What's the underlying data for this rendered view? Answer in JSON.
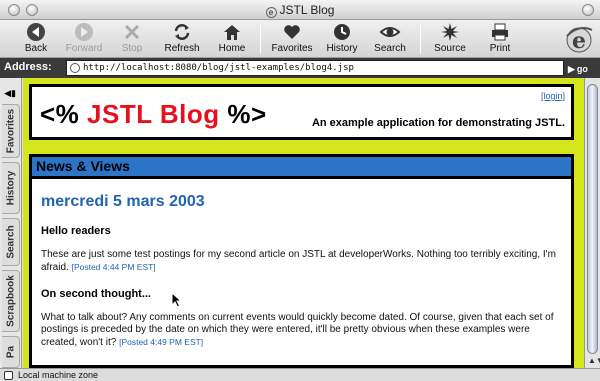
{
  "window": {
    "title": "JSTL Blog"
  },
  "toolbar": {
    "back": "Back",
    "forward": "Forward",
    "stop": "Stop",
    "refresh": "Refresh",
    "home": "Home",
    "favorites": "Favorites",
    "history": "History",
    "search": "Search",
    "source": "Source",
    "print": "Print"
  },
  "address": {
    "label": "Address:",
    "url": "http://localhost:8080/blog/jstl-examples/blog4.jsp",
    "go": "go"
  },
  "explorer_tabs": [
    "Favorites",
    "History",
    "Search",
    "Scrapbook",
    "Pa"
  ],
  "page": {
    "logo_open": "<%",
    "logo_name": "JSTL Blog",
    "logo_close": "%>",
    "login": "[login]",
    "tagline": "An example application for demonstrating JSTL.",
    "section_title": "News & Views",
    "date": "mercredi 5 mars 2003",
    "posts": [
      {
        "title": "Hello readers",
        "body": "These are just some test postings for my second article on JSTL at developerWorks. Nothing too terribly exciting, I'm afraid.",
        "posted": "[Posted 4:44 PM EST]"
      },
      {
        "title": "On second thought...",
        "body": "What to talk about? Any comments on current events would quickly become dated. Of course, given that each set of postings is preceded by the date on which they were entered, it'll be pretty obvious when these examples were created, won't it?",
        "posted": "[Posted 4:49 PM EST]"
      }
    ]
  },
  "status": {
    "zone": "Local machine zone"
  },
  "colors": {
    "page_bg": "#d4e51c",
    "logo_red": "#e8101c",
    "section_blue": "#2b74c6",
    "link_blue": "#2264b0"
  }
}
